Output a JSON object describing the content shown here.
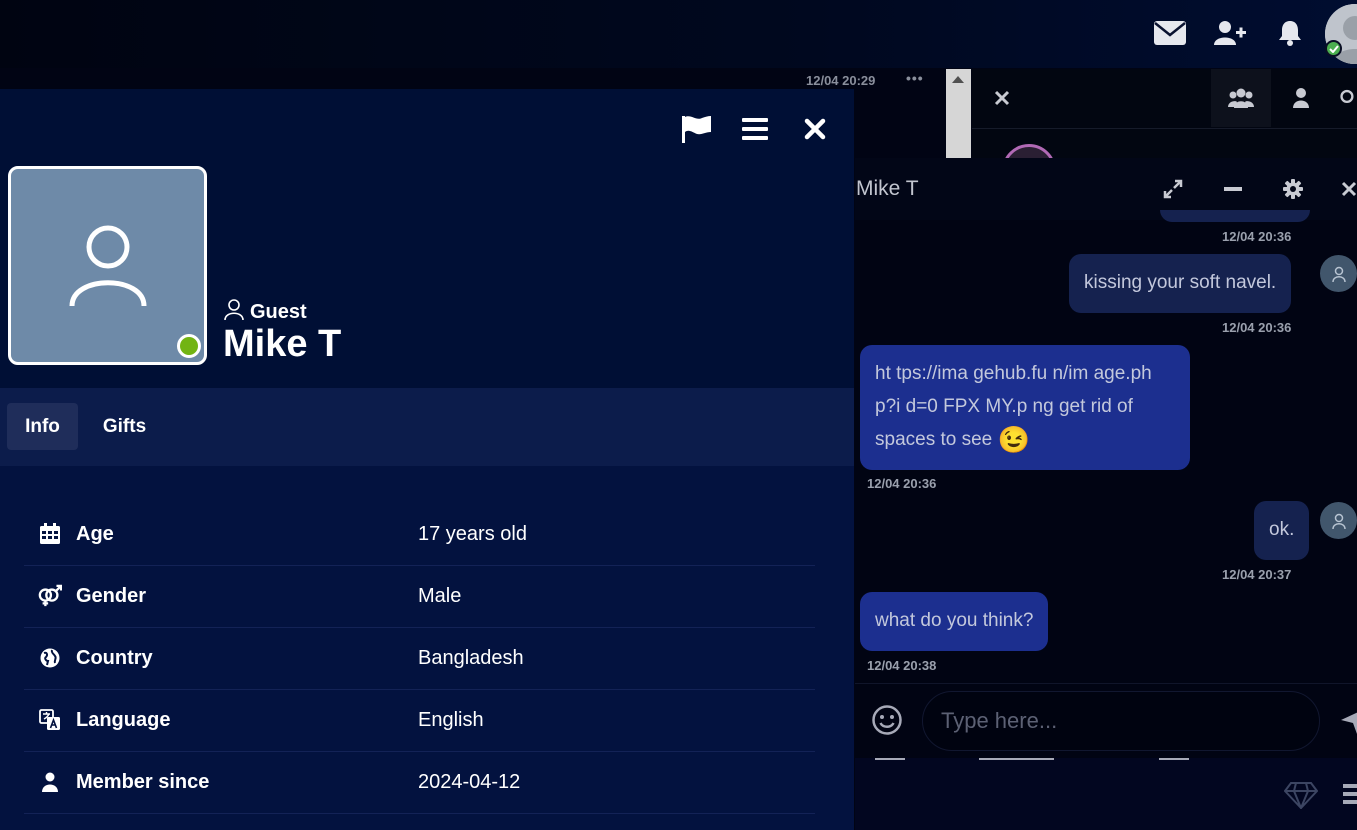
{
  "topbar": {
    "icons": [
      "envelope-icon",
      "add-friend-icon",
      "bell-icon"
    ],
    "online_color": "#4caf50"
  },
  "background_chat": {
    "timestamp": "12/04 20:29",
    "more": "•••"
  },
  "chat": {
    "title": "Mike T",
    "input_placeholder": "Type here...",
    "messages": [
      {
        "text": "kissing your soft navel.",
        "time": "12/04 20:36",
        "own": true
      },
      {
        "text": "ht tps://ima gehub.fu n/im age.ph p?i d=0 FPX MY.p ng get rid of spaces to see",
        "time": "12/04 20:36",
        "own": false,
        "emoji": "😉"
      },
      {
        "text": "ok.",
        "time": "12/04 20:37",
        "own": true
      },
      {
        "text": "what do you think?",
        "time": "12/04 20:38",
        "own": false
      }
    ],
    "first_stamp": "12/04 20:36",
    "colors": {
      "incoming": "#1c2f8f",
      "outgoing": "#15224f"
    }
  },
  "profile": {
    "rank": "Guest",
    "name": "Mike T",
    "status_color": "#72b413",
    "tabs": [
      {
        "label": "Info",
        "active": true
      },
      {
        "label": "Gifts",
        "active": false
      }
    ],
    "info": [
      {
        "label": "Age",
        "value": "17 years old",
        "icon": "calendar-icon"
      },
      {
        "label": "Gender",
        "value": "Male",
        "icon": "gender-icon"
      },
      {
        "label": "Country",
        "value": "Bangladesh",
        "icon": "globe-icon"
      },
      {
        "label": "Language",
        "value": "English",
        "icon": "language-icon"
      },
      {
        "label": "Member since",
        "value": "2024-04-12",
        "icon": "user-icon"
      }
    ]
  }
}
